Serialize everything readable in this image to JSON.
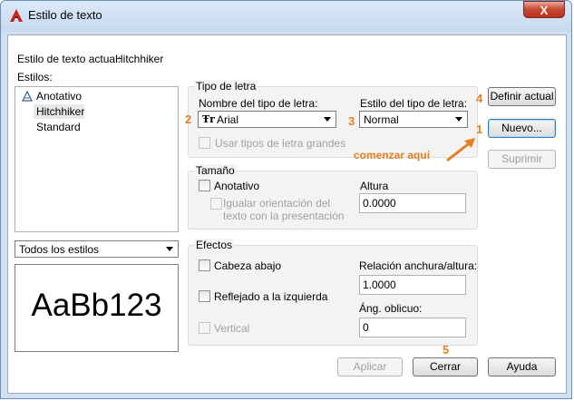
{
  "window": {
    "title": "Estilo de texto",
    "close_glyph": "X"
  },
  "current_style": {
    "label": "Estilo de texto actual:",
    "value": "Hitchhiker"
  },
  "styles": {
    "label": "Estilos:",
    "items": [
      "Anotativo",
      "Hitchhiker",
      "Standard"
    ],
    "selected": "Hitchhiker"
  },
  "filter": {
    "value": "Todos los estilos"
  },
  "preview": {
    "text": "AaBb123"
  },
  "font_group": {
    "title": "Tipo de letra",
    "name_label": "Nombre del tipo de letra:",
    "name_value": "Arial",
    "style_label": "Estilo del tipo de letra:",
    "style_value": "Normal",
    "big_fonts_label": "Usar tipos de letra grandes"
  },
  "size_group": {
    "title": "Tamaño",
    "annotative_label": "Anotativo",
    "match_orientation_label": "Igualar orientación del texto con la presentación",
    "height_label": "Altura",
    "height_value": "0.0000"
  },
  "effects_group": {
    "title": "Efectos",
    "upside_down_label": "Cabeza abajo",
    "backwards_label": "Reflejado a la izquierda",
    "vertical_label": "Vertical",
    "width_factor_label": "Relación anchura/altura:",
    "width_factor_value": "1.0000",
    "oblique_label": "Áng. oblicuo:",
    "oblique_value": "0"
  },
  "buttons": {
    "set_current": "Definir actual",
    "new": "Nuevo...",
    "delete": "Suprimir",
    "apply": "Aplicar",
    "close": "Cerrar",
    "help": "Ayuda"
  },
  "annotations": {
    "n1": "1",
    "n2": "2",
    "n3": "3",
    "n4": "4",
    "n5": "5",
    "hint": "comenzar aquí"
  },
  "colors": {
    "annotation": "#e67e22",
    "title_bar": "#c6d9ef",
    "close_button": "#c7462f"
  }
}
